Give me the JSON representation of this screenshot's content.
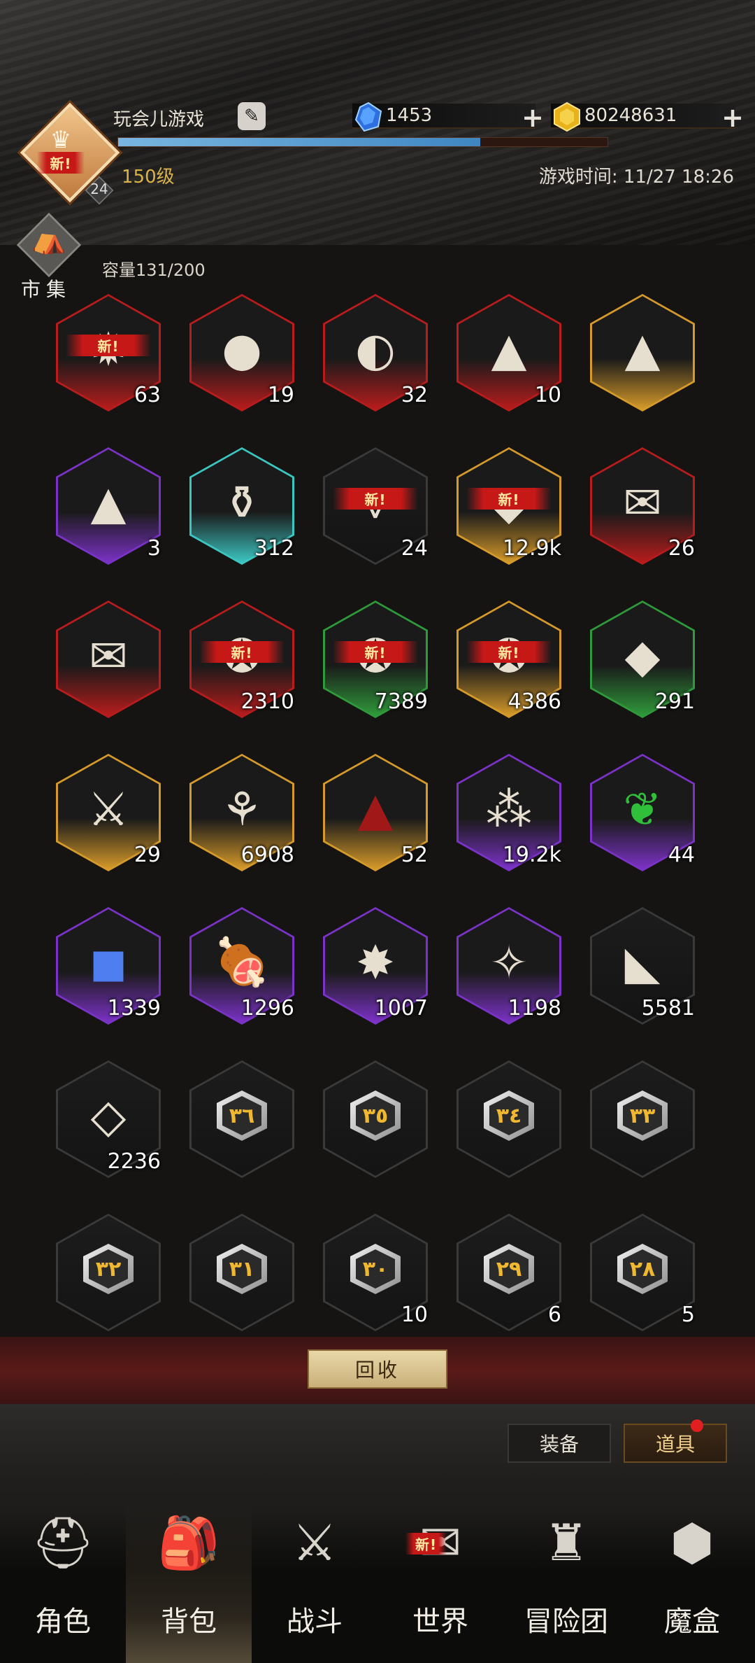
{
  "header": {
    "player_name": "玩会儿游戏",
    "edit_icon": "edit-icon",
    "avatar_badge": "新!",
    "avatar_level_badge": "24",
    "player_level": "150级",
    "xp_fraction": 0.74,
    "game_time": "游戏时间: 11/27 18:26",
    "gems": "1453",
    "gold": "80248631",
    "gem_icon": "blue-gem-icon",
    "gold_icon": "gold-coin-icon",
    "plus_icon": "plus-icon"
  },
  "market": {
    "label": "市集",
    "icon": "market-stall-icon"
  },
  "capacity": "容量131/200",
  "colors": {
    "red": "#b81c1c",
    "orange": "#d69a2a",
    "purple": "#7b32c6",
    "green": "#2f9a3a",
    "cyan": "#3cc6c2",
    "none": "#3a3a3a"
  },
  "items": [
    {
      "icon": "spiked-ore-icon",
      "rarity": "red",
      "count": "63",
      "new": "新!"
    },
    {
      "icon": "moon-rock-icon",
      "rarity": "red",
      "count": "19"
    },
    {
      "icon": "crescent-rock-icon",
      "rarity": "red",
      "count": "32"
    },
    {
      "icon": "sand-pile-icon",
      "rarity": "red",
      "count": "10"
    },
    {
      "icon": "sand-pile-icon",
      "rarity": "orange",
      "count": ""
    },
    {
      "icon": "sand-pile-icon",
      "rarity": "purple",
      "count": "3"
    },
    {
      "icon": "salt-jar-icon",
      "rarity": "cyan",
      "count": "312"
    },
    {
      "icon": "fang-jaw-icon",
      "rarity": "none",
      "count": "24",
      "new": "新!"
    },
    {
      "icon": "crystal-shard-icon",
      "rarity": "orange",
      "count": "12.9k",
      "new": "新!"
    },
    {
      "icon": "scroll-icon",
      "rarity": "red",
      "count": "26"
    },
    {
      "icon": "upgrade-scroll-icon",
      "rarity": "red",
      "count": ""
    },
    {
      "icon": "seal-medal-icon",
      "rarity": "red",
      "count": "2310",
      "new": "新!"
    },
    {
      "icon": "seal-medal-icon",
      "rarity": "green",
      "count": "7389",
      "new": "新!"
    },
    {
      "icon": "seal-medal-icon",
      "rarity": "orange",
      "count": "4386",
      "new": "新!"
    },
    {
      "icon": "crystal-shard-icon",
      "rarity": "green",
      "count": "291"
    },
    {
      "icon": "crossed-swords-medal-icon",
      "rarity": "orange",
      "count": "29"
    },
    {
      "icon": "branch-root-icon",
      "rarity": "orange",
      "count": "6908"
    },
    {
      "icon": "red-dust-icon",
      "rarity": "orange",
      "count": "52"
    },
    {
      "icon": "scattered-shards-icon",
      "rarity": "purple",
      "count": "19.2k"
    },
    {
      "icon": "green-leaf-icon",
      "rarity": "purple",
      "count": "44"
    },
    {
      "icon": "ice-cube-icon",
      "rarity": "purple",
      "count": "1339"
    },
    {
      "icon": "meat-bone-icon",
      "rarity": "purple",
      "count": "1296"
    },
    {
      "icon": "star-burst-icon",
      "rarity": "purple",
      "count": "1007"
    },
    {
      "icon": "crystal-cluster-icon",
      "rarity": "purple",
      "count": "1198"
    },
    {
      "icon": "stone-fragment-icon",
      "rarity": "none",
      "count": "5581"
    },
    {
      "icon": "gem-crystal-icon",
      "rarity": "none",
      "count": "2236"
    },
    {
      "icon": "rune-icon",
      "rarity": "none",
      "count": "",
      "rune": "٣٦"
    },
    {
      "icon": "rune-icon",
      "rarity": "none",
      "count": "",
      "rune": "٣٥"
    },
    {
      "icon": "rune-icon",
      "rarity": "none",
      "count": "",
      "rune": "٣٤"
    },
    {
      "icon": "rune-icon",
      "rarity": "none",
      "count": "",
      "rune": "٣٣"
    },
    {
      "icon": "rune-icon",
      "rarity": "none",
      "count": "",
      "rune": "٣٢"
    },
    {
      "icon": "rune-icon",
      "rarity": "none",
      "count": "",
      "rune": "٣١"
    },
    {
      "icon": "rune-icon",
      "rarity": "none",
      "count": "10",
      "rune": "٣٠"
    },
    {
      "icon": "rune-icon",
      "rarity": "none",
      "count": "6",
      "rune": "٢٩"
    },
    {
      "icon": "rune-icon",
      "rarity": "none",
      "count": "5",
      "rune": "٢٨"
    }
  ],
  "recycle_label": "回收",
  "tabs": {
    "equipment": "装备",
    "items": "道具"
  },
  "nav": [
    {
      "label": "角色",
      "icon": "helmet-icon"
    },
    {
      "label": "背包",
      "icon": "backpack-icon"
    },
    {
      "label": "战斗",
      "icon": "shield-sword-icon"
    },
    {
      "label": "世界",
      "icon": "world-scroll-icon",
      "new": "新!"
    },
    {
      "label": "冒险团",
      "icon": "castle-icon"
    },
    {
      "label": "魔盒",
      "icon": "magic-box-icon"
    }
  ]
}
